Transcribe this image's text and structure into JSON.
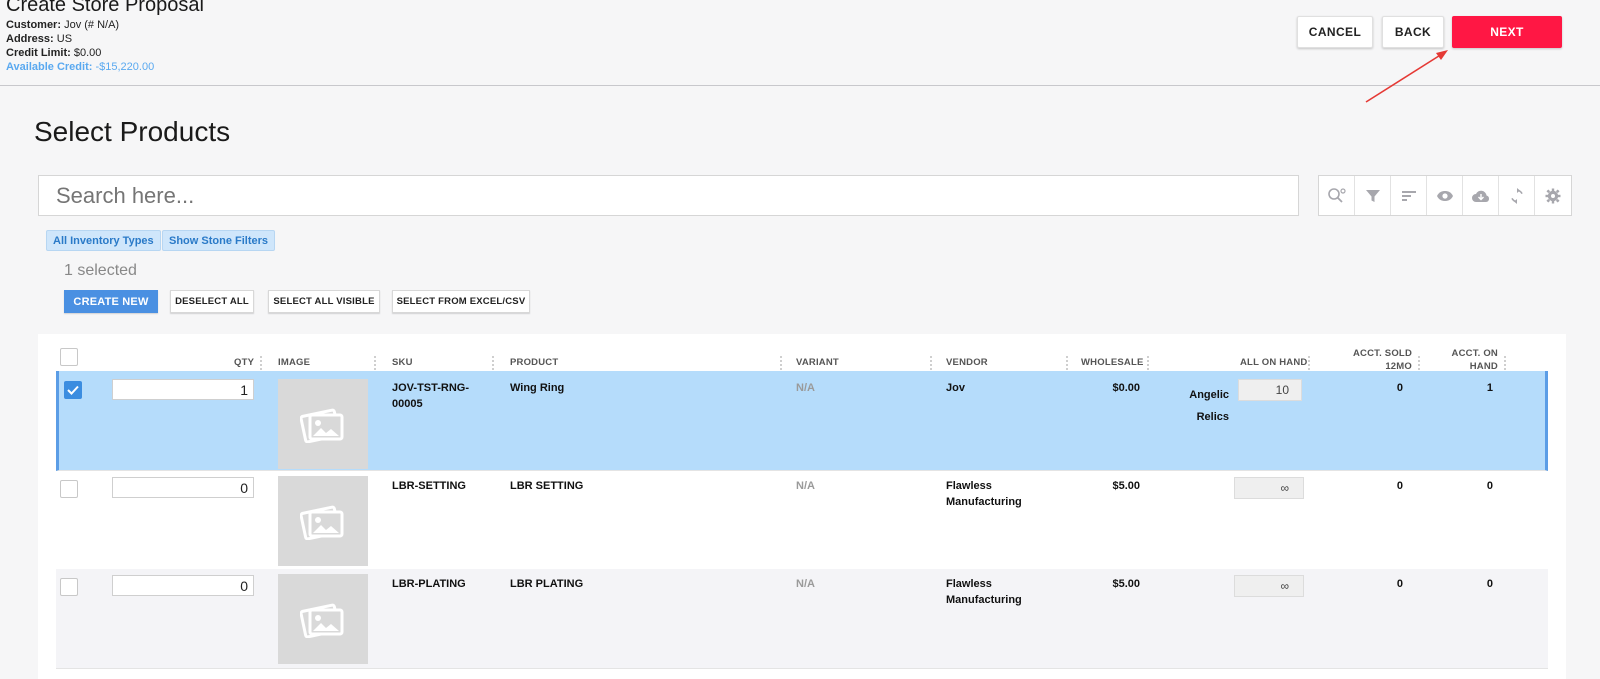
{
  "header": {
    "title": "Create Store Proposal",
    "customer_label": "Customer:",
    "customer_value": "Jov (# N/A)",
    "address_label": "Address:",
    "address_value": "US",
    "credit_limit_label": "Credit Limit:",
    "credit_limit_value": "$0.00",
    "available_credit_label": "Available Credit:",
    "available_credit_value": "-$15,220.00",
    "cancel_label": "CANCEL",
    "back_label": "BACK",
    "next_label": "NEXT"
  },
  "section_title": "Select Products",
  "search": {
    "placeholder": "Search here..."
  },
  "toolbar_icons": [
    "search-settings-icon",
    "filter-icon",
    "sort-icon",
    "eye-icon",
    "cloud-download-icon",
    "refresh-icon",
    "gear-icon"
  ],
  "filters": {
    "inventory_types": "All Inventory Types",
    "stone_filters": "Show Stone Filters"
  },
  "selection": {
    "count_text": "1 selected",
    "create_new": "CREATE NEW",
    "deselect_all": "DESELECT ALL",
    "select_all_visible": "SELECT ALL VISIBLE",
    "select_from_csv": "SELECT FROM EXCEL/CSV"
  },
  "columns": {
    "qty": "QTY",
    "image": "IMAGE",
    "sku": "SKU",
    "product": "PRODUCT",
    "variant": "VARIANT",
    "vendor": "VENDOR",
    "wholesale": "WHOLESALE",
    "all_on_hand": "ALL ON HAND",
    "acct_sold_1": "ACCT. SOLD",
    "acct_sold_2": "12MO",
    "acct_on_hand_1": "ACCT. ON",
    "acct_on_hand_2": "HAND"
  },
  "rows": [
    {
      "selected": true,
      "qty": "1",
      "sku_1": "JOV-TST-RNG-",
      "sku_2": "00005",
      "product": "Wing Ring",
      "variant": "N/A",
      "vendor_1": "Jov",
      "vendor_2": "",
      "wholesale": "$0.00",
      "location_1": "Angelic",
      "location_2": "Relics",
      "on_hand": "10",
      "acct_sold": "0",
      "acct_on_hand": "1"
    },
    {
      "selected": false,
      "qty": "0",
      "sku_1": "LBR-SETTING",
      "sku_2": "",
      "product": "LBR SETTING",
      "variant": "N/A",
      "vendor_1": "Flawless",
      "vendor_2": "Manufacturing",
      "wholesale": "$5.00",
      "location_1": "",
      "location_2": "",
      "on_hand": "∞",
      "acct_sold": "0",
      "acct_on_hand": "0"
    },
    {
      "selected": false,
      "qty": "0",
      "sku_1": "LBR-PLATING",
      "sku_2": "",
      "product": "LBR PLATING",
      "variant": "N/A",
      "vendor_1": "Flawless",
      "vendor_2": "Manufacturing",
      "wholesale": "$5.00",
      "location_1": "",
      "location_2": "",
      "on_hand": "∞",
      "acct_sold": "0",
      "acct_on_hand": "0"
    }
  ],
  "colors": {
    "accent": "#ff1744",
    "primary": "#4a90e2",
    "selected_row": "#b5dcfb",
    "link": "#5aa9f0"
  }
}
